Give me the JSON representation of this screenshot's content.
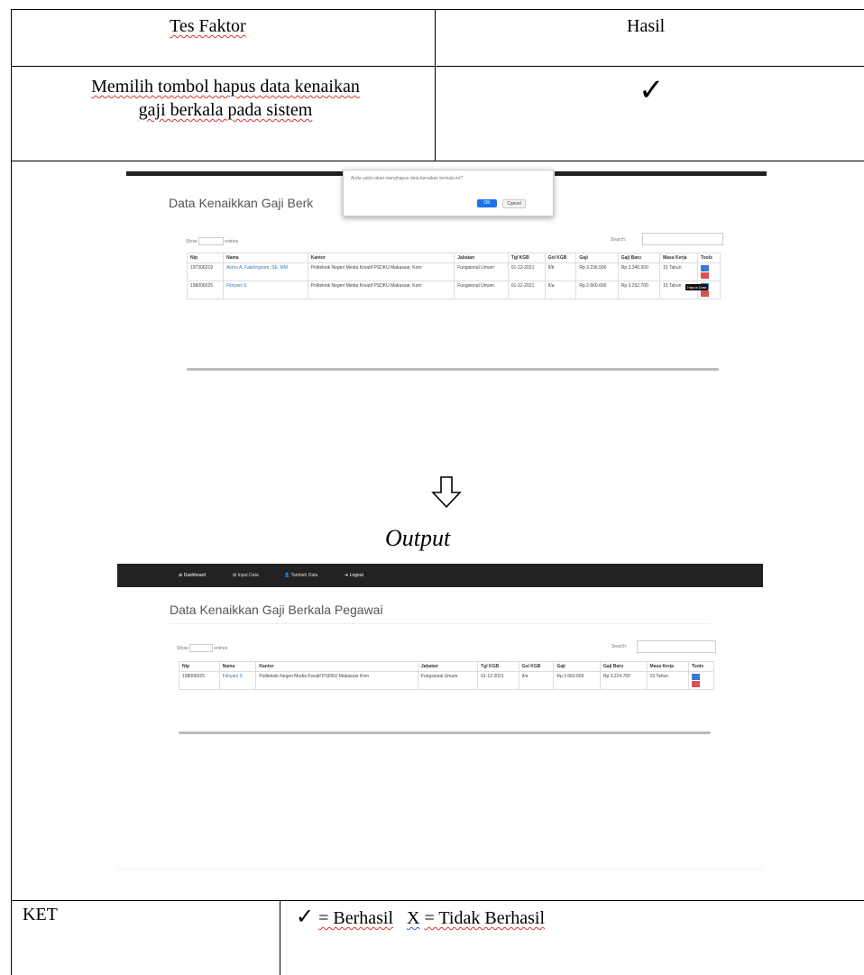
{
  "table": {
    "header_left": "Tes Faktor",
    "header_right": "Hasil",
    "row1_line1": "Memilih tombol hapus data kenaikan",
    "row1_line2": "gaji berkala pada sistem",
    "row1_result": "✓",
    "output_label": "Output",
    "ket_label": "KET",
    "ket_check": "✓",
    "ket_berhasil": "= Berhasil",
    "ket_x": "X",
    "ket_tidak": "= Tidak Berhasil"
  },
  "shot1": {
    "title": "Data Kenaikkan Gaji Berk",
    "dialog_msg": "Anda yakin akan menghapus data kenaikan berkala ini?",
    "ok": "OK",
    "cancel": "Cancel",
    "show_label": "Show",
    "show_value": "10",
    "entries_label": "entries",
    "search_label": "Search:",
    "tooltip": "Hapus Data",
    "columns": [
      "Nip",
      "Nama",
      "Kantor",
      "Jabatan",
      "Tgl KGB",
      "Gol KGB",
      "Gaji",
      "Gaji Baru",
      "Masa Kerja",
      "Tools"
    ],
    "rows": [
      [
        "197306219",
        "Asmo A. Fakiringsom, SE, MM",
        "Politeknik Negeri Media Kreatif PSDKU Makassar, Kom",
        "Fungsional Umum",
        "01-12-2021",
        "II/b",
        "Rp 3.236.500",
        "Rp 3.340.300",
        "15 Tahun"
      ],
      [
        "198006025",
        "Fitriyani S",
        "Politeknik Negeri Media Kreatif PSDKU Makassar, Kom",
        "Fungsional Umum",
        "01-12-2021",
        "II/a",
        "Rp 2.660.600",
        "Rp 3.292.700",
        "15 Tahun"
      ]
    ]
  },
  "shot2": {
    "nav": [
      "Dashboard",
      "Input Data",
      "Tambah Data",
      "Logout"
    ],
    "title": "Data Kenaikkan Gaji Berkala Pegawai",
    "show_label": "Show",
    "show_value": "10",
    "entries_label": "entries",
    "search_label": "Search:",
    "columns": [
      "Nip",
      "Nama",
      "Kantor",
      "Jabatan",
      "Tgl KGB",
      "Gol KGB",
      "Gaji",
      "Gaji Baru",
      "Masa Kerja",
      "Tools"
    ],
    "rows": [
      [
        "198006025",
        "Fitriyani S",
        "Politeknik Negeri Media Kreatif PSDKU Makassar Kom",
        "Fungsional Umum",
        "01-12-2021",
        "II/a",
        "Rp 2.660.600",
        "Rp 3.224.700",
        "15 Tahun"
      ]
    ]
  }
}
